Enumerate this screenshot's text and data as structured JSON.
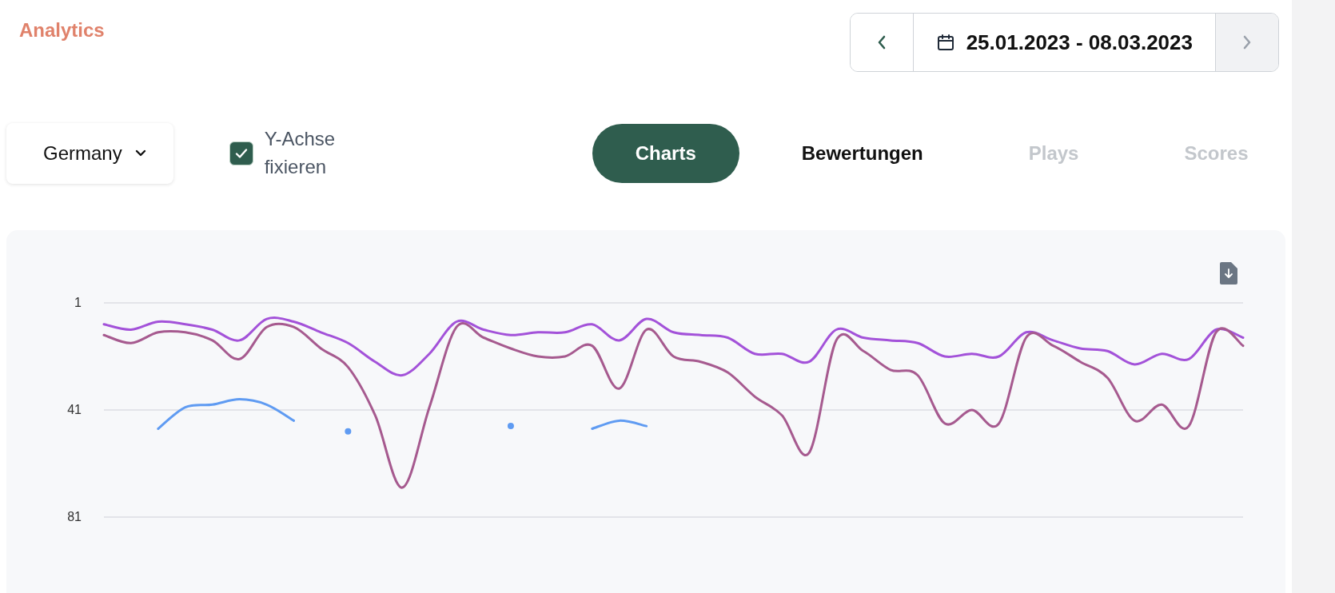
{
  "title": "Analytics",
  "date_range": {
    "label": "25.01.2023 - 08.03.2023",
    "prev_disabled": false,
    "next_disabled": true
  },
  "country": {
    "value": "Germany"
  },
  "fix_y_axis": {
    "label": "Y-Achse fixieren",
    "checked": true
  },
  "tabs": [
    {
      "label": "Charts",
      "selected": true,
      "disabled": false
    },
    {
      "label": "Bewertungen",
      "selected": false,
      "disabled": false
    },
    {
      "label": "Plays",
      "selected": false,
      "disabled": true
    },
    {
      "label": "Scores",
      "selected": false,
      "disabled": true
    }
  ],
  "chart": {
    "chart_data": {
      "type": "line",
      "ylim": [
        81,
        1
      ],
      "yticks": [
        1,
        41,
        81
      ],
      "series": [
        {
          "color": "#a352d9",
          "values": [
            9,
            11,
            8,
            9,
            11,
            15,
            7,
            8,
            12,
            16,
            23,
            28,
            20,
            8,
            11,
            13,
            12,
            12,
            9,
            15,
            7,
            12,
            13,
            14,
            20,
            20,
            23,
            11,
            14,
            15,
            16,
            21,
            20,
            21,
            12,
            15,
            18,
            19,
            24,
            20,
            22,
            11,
            14
          ]
        },
        {
          "color": "#a65a8f",
          "values": [
            13,
            16,
            12,
            12,
            15,
            22,
            10,
            10,
            18,
            25,
            43,
            70,
            40,
            10,
            14,
            18,
            21,
            21,
            17,
            33,
            11,
            21,
            23,
            27,
            36,
            43,
            57,
            15,
            19,
            26,
            28,
            46,
            41,
            46,
            14,
            17,
            23,
            29,
            45,
            39,
            47,
            12,
            17
          ]
        },
        {
          "color": "#5f9bf2",
          "values": [
            null,
            null,
            48,
            40,
            39,
            37,
            39,
            45,
            null,
            49,
            null,
            null,
            null,
            null,
            null,
            47,
            null,
            null,
            48,
            45,
            47,
            null,
            null,
            null,
            null,
            null,
            null,
            null,
            null,
            null,
            null,
            null,
            null,
            null,
            null,
            null,
            null,
            null,
            null,
            null,
            null,
            null,
            null
          ]
        }
      ]
    }
  }
}
